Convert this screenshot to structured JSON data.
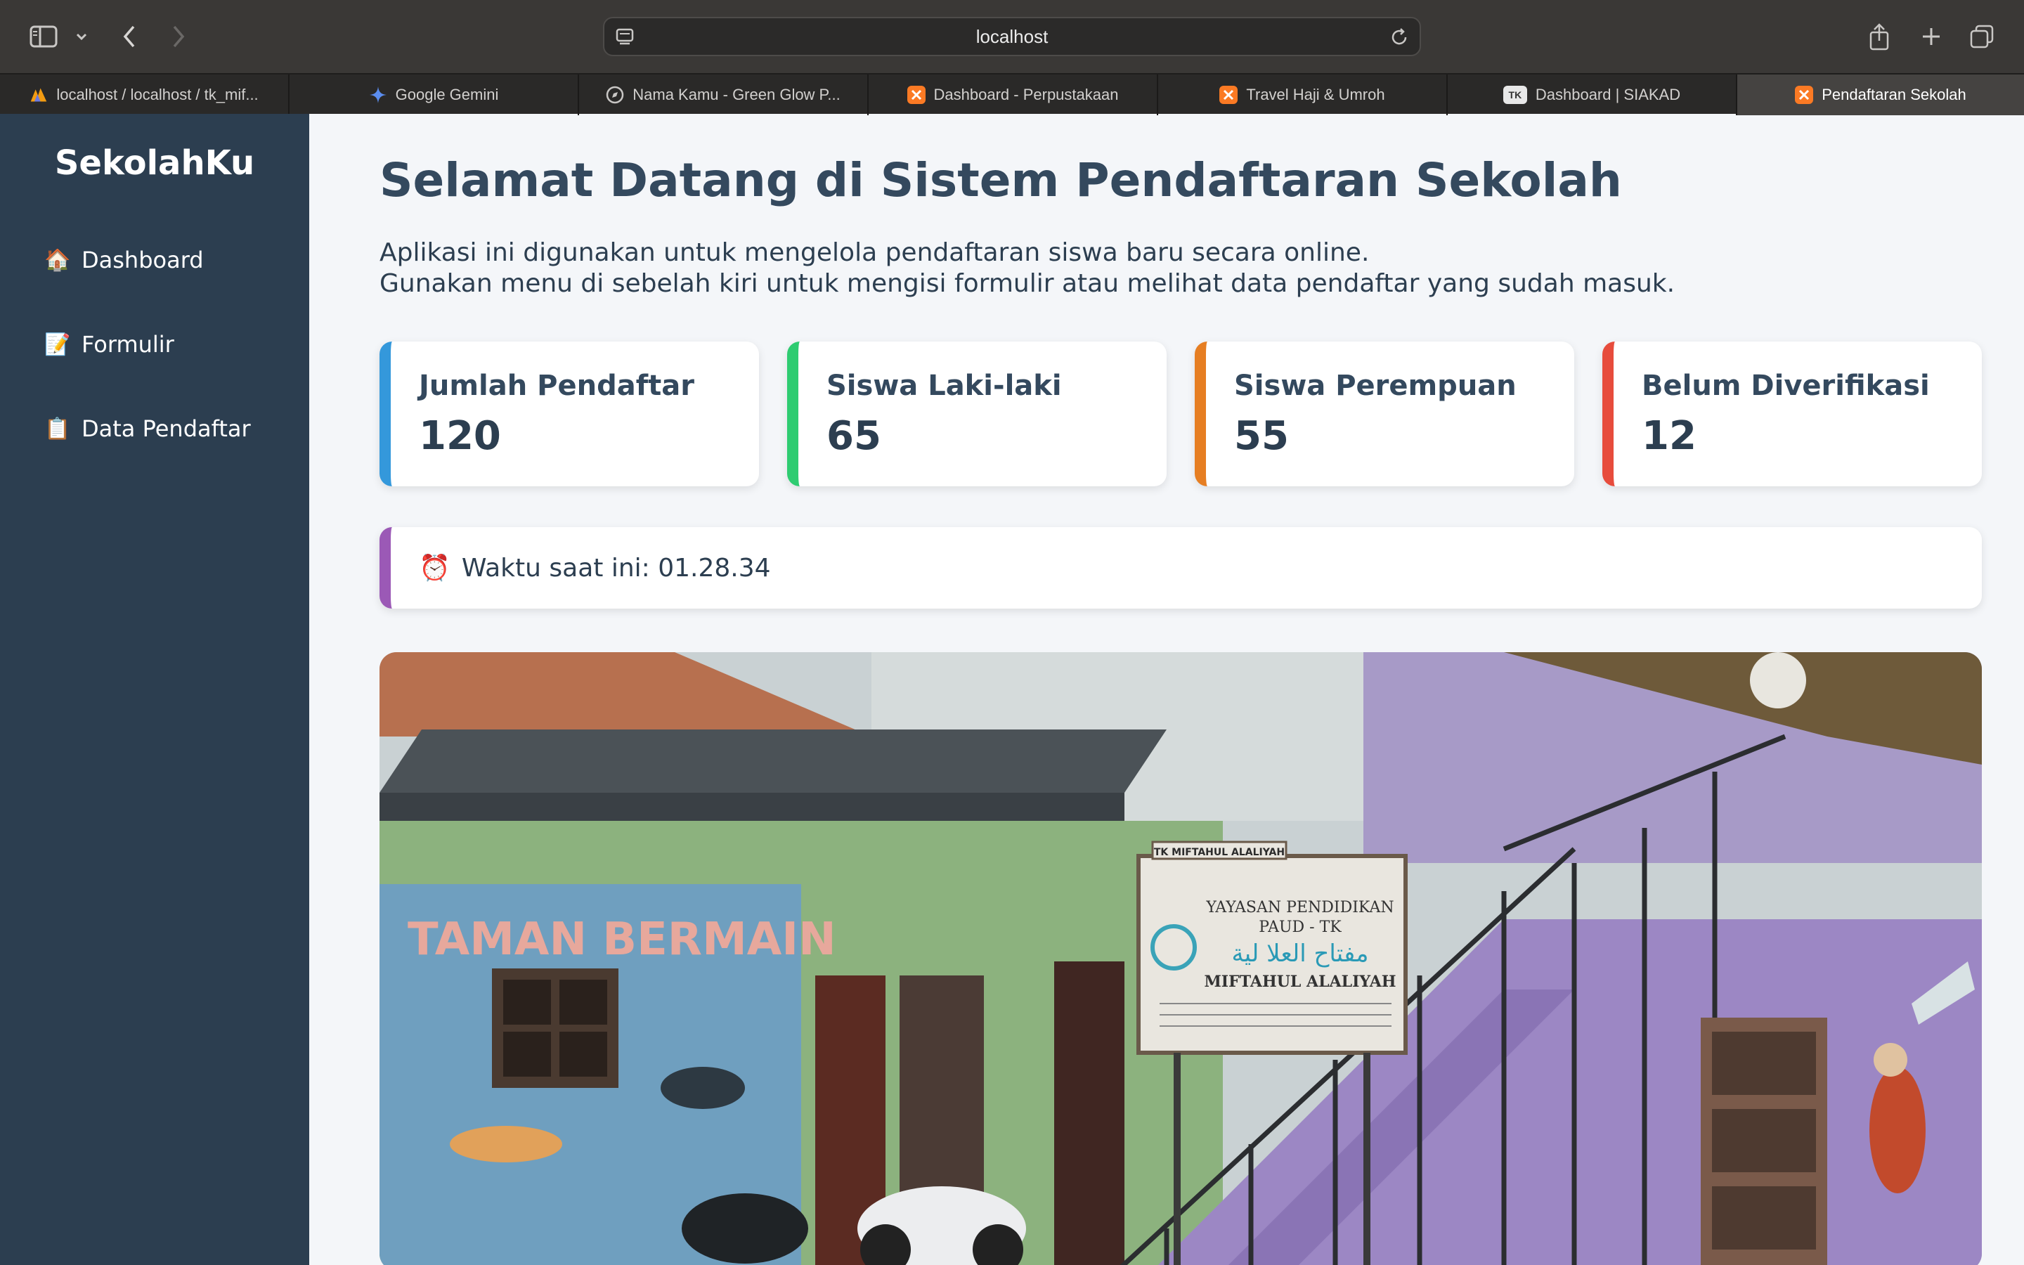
{
  "browser": {
    "address": "localhost",
    "tabs": [
      {
        "label": "localhost / localhost / tk_mif...",
        "icon": "phpmyadmin-icon",
        "active": false
      },
      {
        "label": "Google Gemini",
        "icon": "gemini-icon",
        "active": false
      },
      {
        "label": "Nama Kamu - Green Glow P...",
        "icon": "compass-icon",
        "active": false
      },
      {
        "label": "Dashboard - Perpustakaan",
        "icon": "xampp-icon",
        "active": false
      },
      {
        "label": "Travel Haji & Umroh",
        "icon": "xampp-icon",
        "active": false
      },
      {
        "label": "Dashboard | SIAKAD",
        "icon": "tk-icon",
        "active": false
      },
      {
        "label": "Pendaftaran Sekolah",
        "icon": "xampp-icon",
        "active": true
      }
    ],
    "tk_favicon_text": "TK"
  },
  "sidebar": {
    "brand": "SekolahKu",
    "items": [
      {
        "label": "Dashboard",
        "emoji": "🏠"
      },
      {
        "label": "Formulir",
        "emoji": "📝"
      },
      {
        "label": "Data Pendaftar",
        "emoji": "📋"
      }
    ]
  },
  "main": {
    "title": "Selamat Datang di Sistem Pendaftaran Sekolah",
    "intro_line1": "Aplikasi ini digunakan untuk mengelola pendaftaran siswa baru secara online.",
    "intro_line2": "Gunakan menu di sebelah kiri untuk mengisi formulir atau melihat data pendaftar yang sudah masuk.",
    "cards": [
      {
        "label": "Jumlah Pendaftar",
        "value": "120",
        "color": "#3498db"
      },
      {
        "label": "Siswa Laki-laki",
        "value": "65",
        "color": "#2ecc71"
      },
      {
        "label": "Siswa Perempuan",
        "value": "55",
        "color": "#e67e22"
      },
      {
        "label": "Belum Diverifikasi",
        "value": "12",
        "color": "#e74c3c"
      }
    ],
    "clock": {
      "emoji": "⏰",
      "text": "Waktu saat ini: 01.28.34",
      "color": "#9b59b6"
    },
    "photo": {
      "mural_text": "TAMAN BERMAIN",
      "sign_lines": [
        "YAYASAN PENDIDIKAN",
        "PAUD - TK",
        "مفتاح العلا لية",
        "MIFTAHUL ALALIYAH"
      ],
      "small_sign": "TK MIFTAHUL ALALIYAH"
    }
  },
  "colors": {
    "sidebar": "#2c3e50",
    "page": "#f4f6f9",
    "title": "#34495e"
  }
}
